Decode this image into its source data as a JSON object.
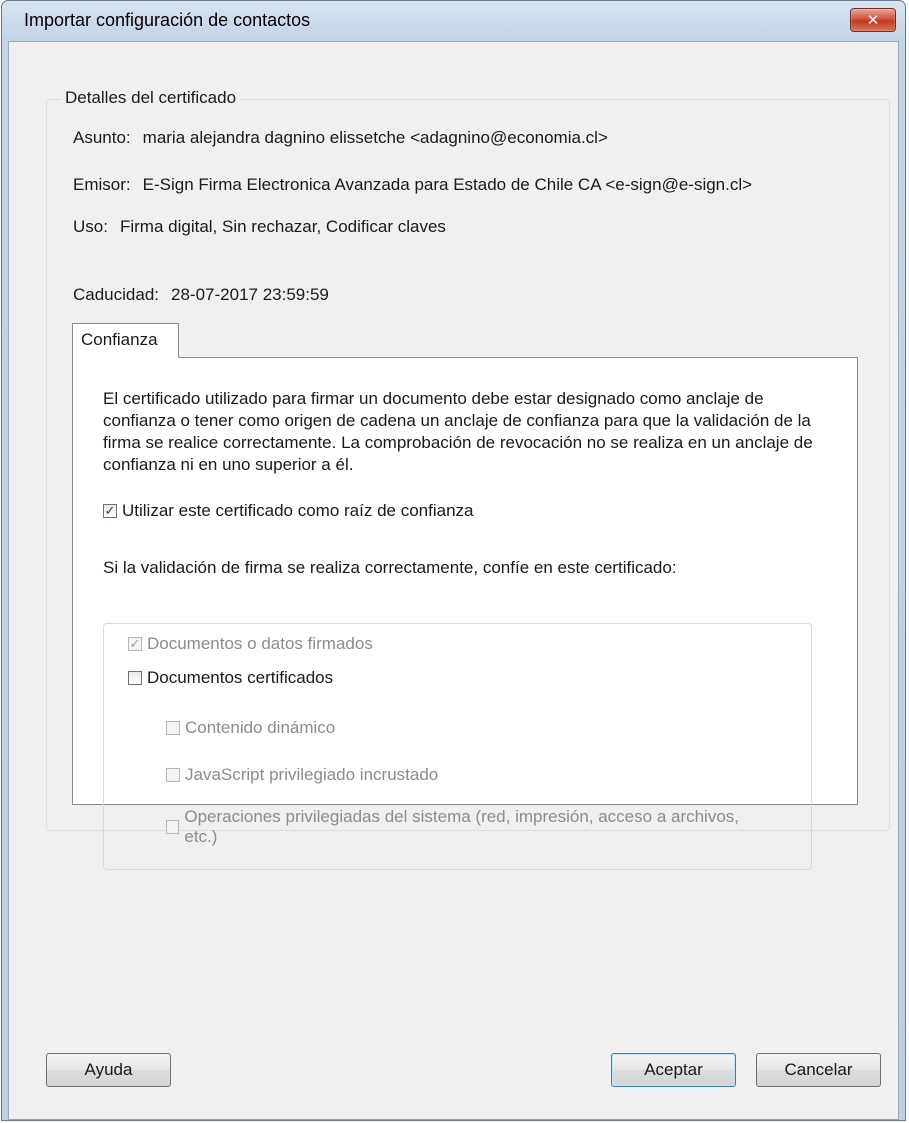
{
  "window": {
    "title": "Importar configuración de contactos",
    "close_label": "✕"
  },
  "certificate_details": {
    "legend": "Detalles del certificado",
    "subject_label": "Asunto:",
    "subject_value": "maria alejandra dagnino elissetche <adagnino@economia.cl>",
    "issuer_label": "Emisor:",
    "issuer_value": "E-Sign Firma Electronica Avanzada para Estado de Chile CA <e-sign@e-sign.cl>",
    "usage_label": "Uso:",
    "usage_value": "Firma digital, Sin rechazar, Codificar claves",
    "expiry_label": "Caducidad:",
    "expiry_value": "28-07-2017 23:59:59"
  },
  "trust_tab": {
    "label": "Confianza",
    "description": "El certificado utilizado para firmar un documento debe estar designado como anclaje de confianza o tener como origen de cadena un anclaje de confianza para que la validación de la firma se realice correctamente. La comprobación de revocación no se realiza en un anclaje de confianza ni en uno superior a él.",
    "use_as_root_label": "Utilizar este certificado como raíz de confianza",
    "use_as_root_checked": true,
    "trust_question": "Si la validación de firma se realiza correctamente, confíe en este certificado:",
    "options": {
      "signed_docs_label": "Documentos o datos firmados",
      "signed_docs_checked": true,
      "certified_docs_label": "Documentos certificados",
      "certified_docs_checked": false,
      "dynamic_content_label": "Contenido dinámico",
      "dynamic_content_checked": false,
      "embedded_js_label": "JavaScript privilegiado incrustado",
      "embedded_js_checked": false,
      "system_ops_label": "Operaciones privilegiadas del sistema (red, impresión, acceso a archivos, etc.)",
      "system_ops_checked": false
    }
  },
  "buttons": {
    "help": "Ayuda",
    "ok": "Aceptar",
    "cancel": "Cancelar"
  },
  "check_glyph": "✓"
}
